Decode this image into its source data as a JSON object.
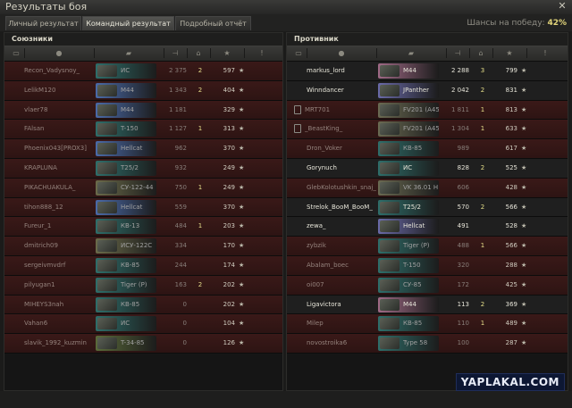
{
  "window": {
    "title": "Результаты боя",
    "close": "✕"
  },
  "tabs": [
    {
      "label": "Личный результат",
      "active": false
    },
    {
      "label": "Командный результат",
      "active": true
    },
    {
      "label": "Подробный отчёт",
      "active": false
    }
  ],
  "chance": {
    "label": "Шансы на победу:",
    "value": "42%"
  },
  "allies": {
    "title": "Союзники",
    "header_icons": [
      "chat-icon",
      "player-icon",
      "sort-arrow-icon",
      "damage-icon",
      "tank-kills-icon",
      "xp-star-icon",
      "info-icon"
    ],
    "rows": [
      {
        "name": "Recon_Vadysnoy_",
        "tank": "ИС",
        "tank_color": "#2e6e6a",
        "damage": "2 375",
        "kills": "2",
        "xp": "597",
        "alive": false
      },
      {
        "name": "LelikM120",
        "tank": "M44",
        "tank_color": "#4a6aa8",
        "damage": "1 343",
        "kills": "2",
        "xp": "404",
        "alive": false
      },
      {
        "name": "vlaer78",
        "tank": "M44",
        "tank_color": "#4a6aa8",
        "damage": "1 181",
        "kills": "",
        "xp": "329",
        "alive": false
      },
      {
        "name": "FAlsan",
        "tank": "T-150",
        "tank_color": "#2e6e6a",
        "damage": "1 127",
        "kills": "1",
        "xp": "313",
        "alive": false
      },
      {
        "name": "Phoenix043[PROX3]",
        "tank": "Hellcat",
        "tank_color": "#4a6aa8",
        "damage": "962",
        "kills": "",
        "xp": "370",
        "alive": false
      },
      {
        "name": "KRAPLUNA",
        "tank": "T25/2",
        "tank_color": "#2e6e6a",
        "damage": "932",
        "kills": "",
        "xp": "249",
        "alive": false
      },
      {
        "name": "PIKACHUAKULA_",
        "tank": "СУ-122-44",
        "tank_color": "#6b6b4a",
        "damage": "750",
        "kills": "1",
        "xp": "249",
        "alive": false
      },
      {
        "name": "tihon888_12",
        "tank": "Hellcat",
        "tank_color": "#4a6aa8",
        "damage": "559",
        "kills": "",
        "xp": "370",
        "alive": false
      },
      {
        "name": "Fureur_1",
        "tank": "КВ-13",
        "tank_color": "#2e6e6a",
        "damage": "484",
        "kills": "1",
        "xp": "203",
        "alive": false
      },
      {
        "name": "dmitrich09",
        "tank": "ИСУ-122С",
        "tank_color": "#6b6b4a",
        "damage": "334",
        "kills": "",
        "xp": "170",
        "alive": false
      },
      {
        "name": "sergeivmvdrf",
        "tank": "КВ-85",
        "tank_color": "#2e6e6a",
        "damage": "244",
        "kills": "",
        "xp": "174",
        "alive": false
      },
      {
        "name": "pilyugan1",
        "tank": "Tiger (P)",
        "tank_color": "#2e6e6a",
        "damage": "163",
        "kills": "2",
        "xp": "202",
        "alive": false
      },
      {
        "name": "MIHEYS3nah",
        "tank": "КВ-85",
        "tank_color": "#2e6e6a",
        "damage": "0",
        "kills": "",
        "xp": "202",
        "alive": false
      },
      {
        "name": "Vahan6",
        "tank": "ИС",
        "tank_color": "#2e6e6a",
        "damage": "0",
        "kills": "",
        "xp": "104",
        "alive": false
      },
      {
        "name": "slavik_1992_kuzmin",
        "tank": "T-34-85",
        "tank_color": "#5a6a3a",
        "damage": "0",
        "kills": "",
        "xp": "126",
        "alive": false
      }
    ]
  },
  "enemies": {
    "title": "Противник",
    "header_icons": [
      "chat-icon",
      "player-icon",
      "sort-arrow-icon",
      "damage-icon",
      "tank-kills-icon",
      "xp-star-icon",
      "info-icon"
    ],
    "rows": [
      {
        "name": "markus_lord",
        "tank": "M44",
        "tank_color": "#a06a86",
        "damage": "2 288",
        "kills": "3",
        "xp": "799",
        "alive": true,
        "flag": false
      },
      {
        "name": "Winndancer",
        "tank": "JPanther",
        "tank_color": "#6a6aa8",
        "damage": "2 042",
        "kills": "2",
        "xp": "831",
        "alive": true,
        "flag": false
      },
      {
        "name": "MRT701",
        "tank": "FV201 (A45)",
        "tank_color": "#6a6a52",
        "damage": "1 811",
        "kills": "1",
        "xp": "813",
        "alive": false,
        "flag": true
      },
      {
        "name": "_BeastKing_",
        "tank": "FV201 (A45)",
        "tank_color": "#6a6a52",
        "damage": "1 304",
        "kills": "1",
        "xp": "633",
        "alive": false,
        "flag": true
      },
      {
        "name": "Dron_Voker",
        "tank": "КВ-85",
        "tank_color": "#2e6e6a",
        "damage": "989",
        "kills": "",
        "xp": "617",
        "alive": false,
        "flag": false
      },
      {
        "name": "Gorynuch",
        "tank": "ИС",
        "tank_color": "#2e6e6a",
        "damage": "828",
        "kills": "2",
        "xp": "525",
        "alive": true,
        "flag": false
      },
      {
        "name": "GlebKolotushkin_snaj_",
        "tank": "VK 36.01 H",
        "tank_color": "#6a6a52",
        "damage": "606",
        "kills": "",
        "xp": "428",
        "alive": false,
        "flag": false
      },
      {
        "name": "Strelok_BooM_BooM_",
        "tank": "T25/2",
        "tank_color": "#2e6e6a",
        "damage": "570",
        "kills": "2",
        "xp": "566",
        "alive": true,
        "flag": false
      },
      {
        "name": "zewa_",
        "tank": "Hellcat",
        "tank_color": "#6a6aa8",
        "damage": "491",
        "kills": "",
        "xp": "528",
        "alive": true,
        "flag": false
      },
      {
        "name": "zybzik",
        "tank": "Tiger (P)",
        "tank_color": "#2e6e6a",
        "damage": "488",
        "kills": "1",
        "xp": "566",
        "alive": false,
        "flag": false
      },
      {
        "name": "Abalam_boec",
        "tank": "T-150",
        "tank_color": "#2e6e6a",
        "damage": "320",
        "kills": "",
        "xp": "288",
        "alive": false,
        "flag": false
      },
      {
        "name": "oi007",
        "tank": "СУ-85",
        "tank_color": "#2e6e6a",
        "damage": "172",
        "kills": "",
        "xp": "425",
        "alive": false,
        "flag": false
      },
      {
        "name": "Ligavictora",
        "tank": "M44",
        "tank_color": "#a06a86",
        "damage": "113",
        "kills": "2",
        "xp": "369",
        "alive": true,
        "flag": false
      },
      {
        "name": "Milep",
        "tank": "КВ-85",
        "tank_color": "#2e6e6a",
        "damage": "110",
        "kills": "1",
        "xp": "489",
        "alive": false,
        "flag": false
      },
      {
        "name": "novostroika6",
        "tank": "Type 58",
        "tank_color": "#2e6e6a",
        "damage": "100",
        "kills": "",
        "xp": "287",
        "alive": false,
        "flag": false
      }
    ]
  },
  "watermark": "YAPLAKAL.COM"
}
